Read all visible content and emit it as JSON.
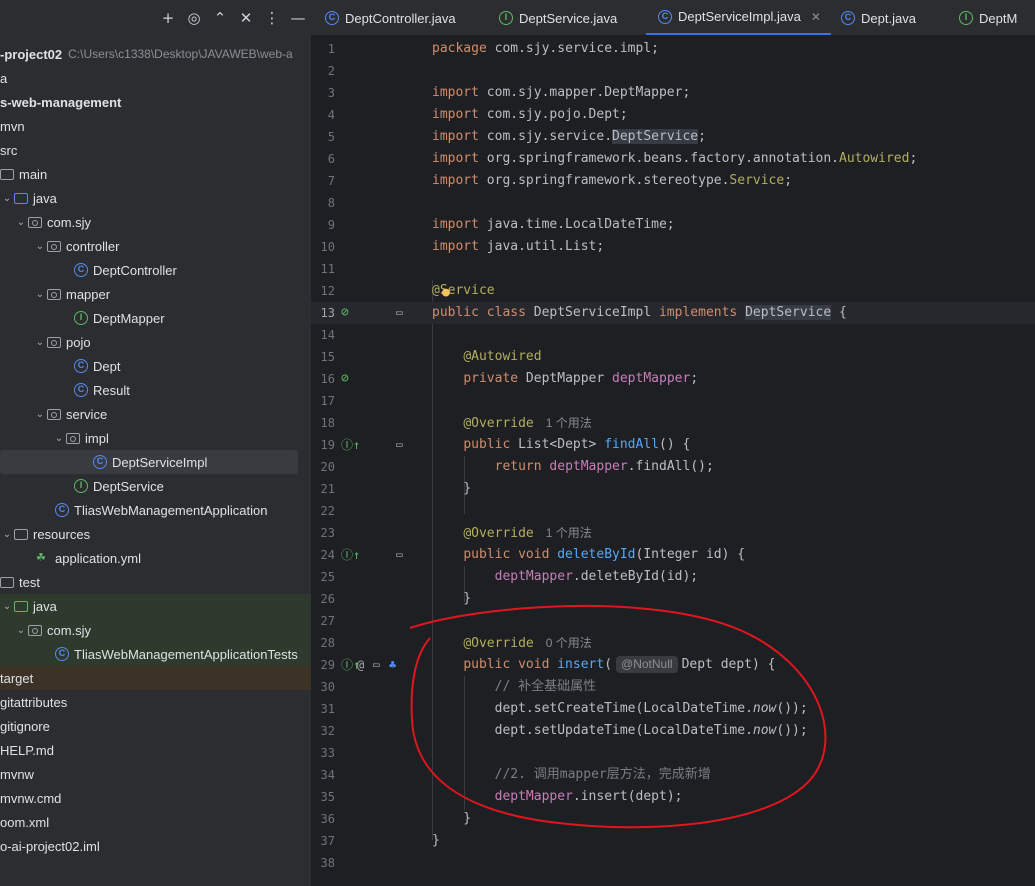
{
  "project": {
    "root_name": "-project02",
    "root_path": "C:\\Users\\c1338\\Desktop\\JAVAWEB\\web-a",
    "items": [
      {
        "label": "a"
      },
      {
        "label": "s-web-management"
      },
      {
        "label": "mvn"
      },
      {
        "label": "src"
      },
      {
        "label": "main"
      },
      {
        "label": "java"
      },
      {
        "label": "com.sjy"
      },
      {
        "label": "controller"
      },
      {
        "label": "DeptController"
      },
      {
        "label": "mapper"
      },
      {
        "label": "DeptMapper"
      },
      {
        "label": "pojo"
      },
      {
        "label": "Dept"
      },
      {
        "label": "Result"
      },
      {
        "label": "service"
      },
      {
        "label": "impl"
      },
      {
        "label": "DeptServiceImpl"
      },
      {
        "label": "DeptService"
      },
      {
        "label": "TliasWebManagementApplication"
      },
      {
        "label": "resources"
      },
      {
        "label": "application.yml"
      },
      {
        "label": "test"
      },
      {
        "label": "java"
      },
      {
        "label": "com.sjy"
      },
      {
        "label": "TliasWebManagementApplicationTests"
      },
      {
        "label": "target"
      },
      {
        "label": "gitattributes"
      },
      {
        "label": "gitignore"
      },
      {
        "label": "HELP.md"
      },
      {
        "label": "mvnw"
      },
      {
        "label": "mvnw.cmd"
      },
      {
        "label": "oom.xml"
      },
      {
        "label": "o-ai-project02.iml"
      }
    ]
  },
  "tabs": [
    {
      "label": "DeptController.java",
      "icon": "class-icon"
    },
    {
      "label": "DeptService.java",
      "icon": "interface-icon"
    },
    {
      "label": "DeptServiceImpl.java",
      "icon": "class-icon",
      "active": true
    },
    {
      "label": "Dept.java",
      "icon": "class-icon"
    },
    {
      "label": "DeptM",
      "icon": "interface-icon"
    }
  ],
  "editor": {
    "line_numbers": [
      "1",
      "2",
      "3",
      "4",
      "5",
      "6",
      "7",
      "8",
      "9",
      "10",
      "11",
      "12",
      "13",
      "14",
      "15",
      "16",
      "17",
      "18",
      "19",
      "20",
      "21",
      "22",
      "23",
      "24",
      "25",
      "26",
      "27",
      "28",
      "29",
      "30",
      "31",
      "32",
      "33",
      "34",
      "35",
      "36",
      "37",
      "38"
    ],
    "current_line": "13",
    "usage_hints": {
      "find_all": "1 个用法",
      "delete_by_id": "1 个用法",
      "insert": "0 个用法"
    },
    "inlay_notnull": "@NotNull",
    "comment_1": "// 补全基础属性",
    "comment_2": "//2. 调用mapper层方法，完成新增"
  },
  "colors": {
    "accent": "#3574f0",
    "annotation_circle": "#e0161f"
  }
}
